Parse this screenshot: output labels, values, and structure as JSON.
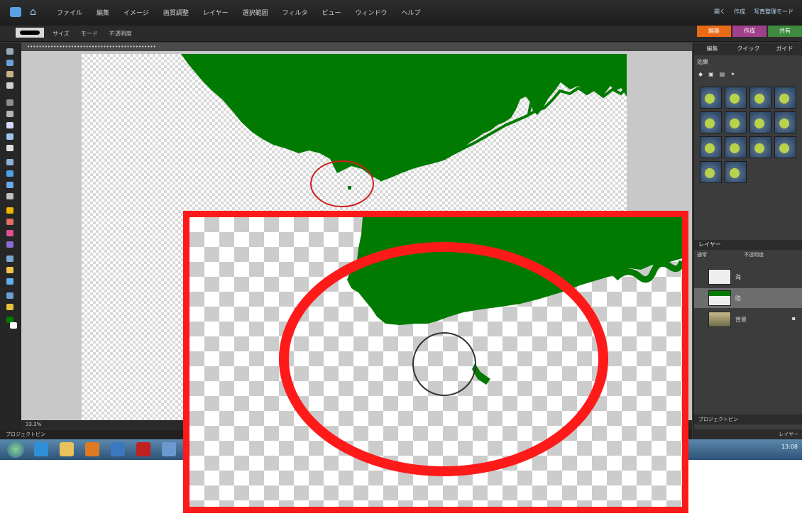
{
  "menubar": {
    "items": [
      "ファイル",
      "編集",
      "イメージ",
      "画質調整",
      "レイヤー",
      "選択範囲",
      "フィルタ",
      "ビュー",
      "ウィンドウ",
      "ヘルプ"
    ],
    "right": [
      "開く",
      "作成",
      "写真整理モード"
    ]
  },
  "options": {
    "items": [
      "サイズ",
      "モード",
      "不透明度"
    ]
  },
  "mode_tabs": [
    {
      "label": "編集",
      "color": "#e86a17"
    },
    {
      "label": "作成",
      "color": "#a0408c"
    },
    {
      "label": "共有",
      "color": "#3e8a3e"
    }
  ],
  "document": {
    "status": "33.3%"
  },
  "bottom_strip": {
    "label": "プロジェクトビン"
  },
  "panel": {
    "tabs": [
      "編集",
      "クイック",
      "ガイド"
    ],
    "section": "効果",
    "layers_title": "レイヤー",
    "layers_mode": "通常",
    "layers_opacity": "不透明度",
    "layer_names": [
      "海",
      "陸",
      "背景"
    ],
    "foot": "プロジェクトビン",
    "foot2": "レイヤー"
  },
  "taskbar": {
    "time": "13:08"
  },
  "colors": {
    "land": "#007a00",
    "highlight": "#ff1a1a",
    "accent_orange": "#e86a17"
  }
}
